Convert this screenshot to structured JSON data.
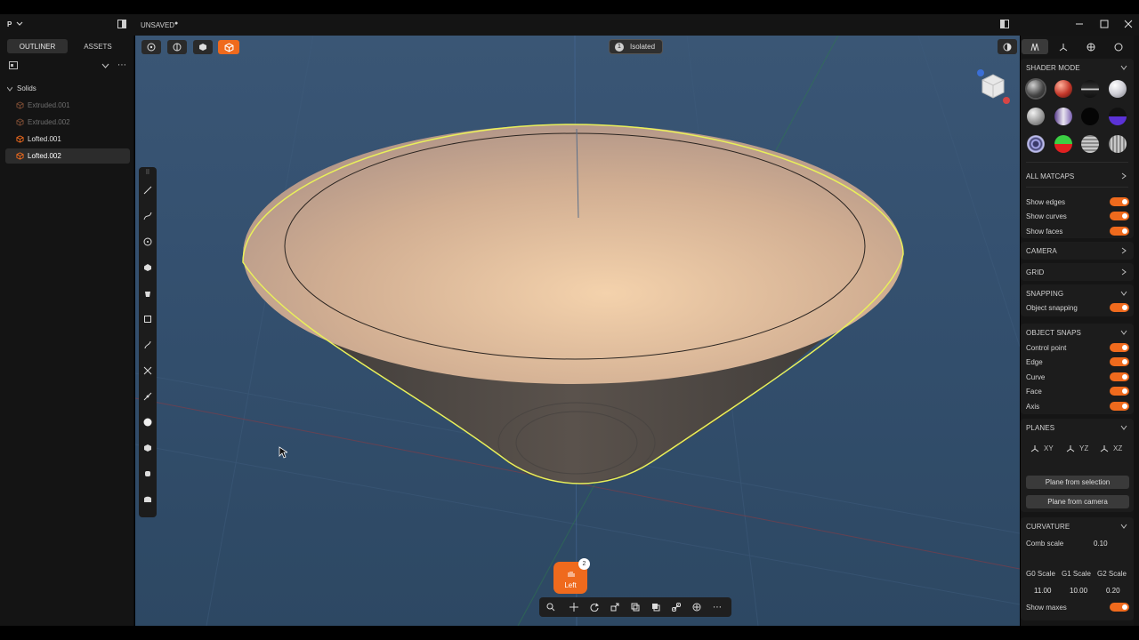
{
  "titlebar": {
    "app_logo": "P",
    "app_menu_icon": "chevron-down-icon",
    "doc_name": "UNSAVED",
    "unsaved_dot": "●"
  },
  "outliner": {
    "tabs": [
      {
        "label": "OUTLINER",
        "active": true
      },
      {
        "label": "ASSETS",
        "active": false
      }
    ],
    "group_label": "Solids",
    "items": [
      {
        "label": "Extruded.001",
        "hidden": true
      },
      {
        "label": "Extruded.002",
        "hidden": true
      },
      {
        "label": "Lofted.001",
        "hidden": false
      },
      {
        "label": "Lofted.002",
        "hidden": false,
        "selected": true
      }
    ]
  },
  "viewport": {
    "isolated_badge": "Isolated",
    "isolated_count": "1",
    "view_badge": "Left",
    "view_count": "2",
    "gizmo_axis_x": "x",
    "gizmo_axis_z": "z",
    "colors": {
      "accent": "#ef6a1d",
      "selection": "#e9f05a",
      "background": "#34506f"
    }
  },
  "right_panel": {
    "shader_mode": {
      "title": "SHADER MODE"
    },
    "all_matcaps": "ALL MATCAPS",
    "show_edges": "Show edges",
    "show_curves": "Show curves",
    "show_faces": "Show faces",
    "camera": "CAMERA",
    "grid": "GRID",
    "snapping": {
      "title": "SNAPPING",
      "object_snapping": "Object snapping"
    },
    "object_snaps": {
      "title": "OBJECT SNAPS",
      "items": [
        "Control point",
        "Edge",
        "Curve",
        "Face",
        "Axis"
      ]
    },
    "planes": {
      "title": "PLANES",
      "xy": "XY",
      "yz": "YZ",
      "xz": "XZ",
      "from_selection": "Plane from selection",
      "from_camera": "Plane from camera"
    },
    "curvature": {
      "title": "CURVATURE",
      "comb_scale_label": "Comb scale",
      "comb_scale_value": "0.10",
      "g0_label": "G0 Scale",
      "g1_label": "G1 Scale",
      "g2_label": "G2 Scale",
      "g0_value": "11.00",
      "g1_value": "10.00",
      "g2_value": "0.20",
      "show_maxes": "Show maxes"
    }
  }
}
